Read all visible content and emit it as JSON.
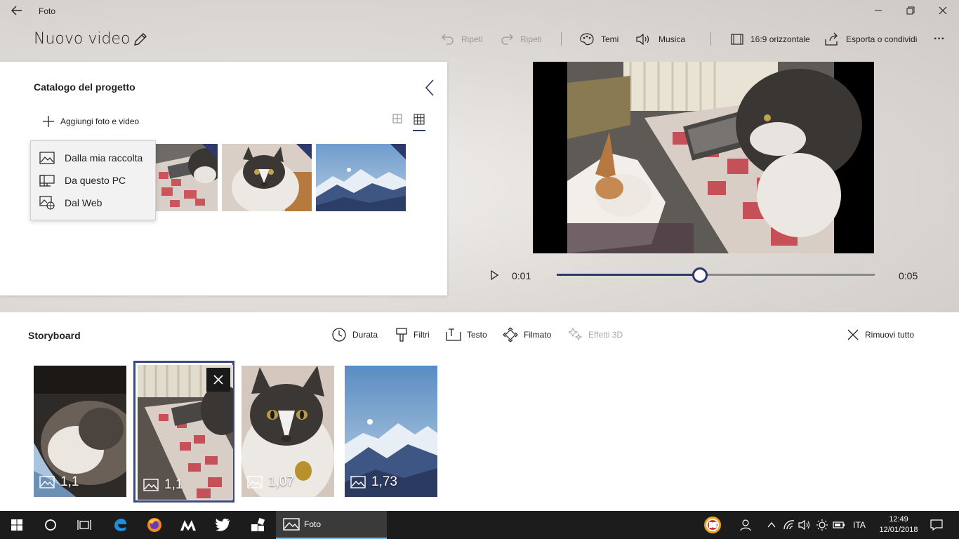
{
  "window": {
    "app_title": "Foto",
    "back_icon": "back-arrow-icon",
    "controls": [
      "minimize-icon",
      "restore-icon",
      "close-icon"
    ]
  },
  "header": {
    "project_title": "Nuovo video",
    "edit_icon": "pencil-icon",
    "undo_label": "Ripeti",
    "redo_label": "Ripeti",
    "themes_label": "Temi",
    "music_label": "Musica",
    "aspect_label": "16:9 orizzontale",
    "export_label": "Esporta o condividi",
    "more_label": "···"
  },
  "catalog": {
    "title": "Catalogo del progetto",
    "add_label": "Aggiungi foto e video",
    "add_menu": [
      {
        "label": "Dalla mia raccolta",
        "icon": "collection-icon"
      },
      {
        "label": "Da questo PC",
        "icon": "pc-icon"
      },
      {
        "label": "Dal Web",
        "icon": "web-icon"
      }
    ],
    "thumbnails": [
      "cat-on-mat",
      "cat-portrait",
      "mountains"
    ]
  },
  "preview": {
    "time_current": "0:01",
    "time_total": "0:05",
    "progress": 0.45
  },
  "storyboard": {
    "title": "Storyboard",
    "tools": {
      "duration": "Durata",
      "filters": "Filtri",
      "text": "Testo",
      "motion": "Filmato",
      "effects3d": "Effetti 3D",
      "remove_all": "Rimuovi tutto"
    },
    "clips": [
      {
        "duration": "1,1",
        "scene": "cat-sleeping"
      },
      {
        "duration": "1,1",
        "scene": "cat-on-mat",
        "selected": true
      },
      {
        "duration": "1,07",
        "scene": "cat-portrait"
      },
      {
        "duration": "1,73",
        "scene": "mountains"
      }
    ]
  },
  "taskbar": {
    "active_app": "Foto",
    "language": "ITA",
    "time": "12:49",
    "date": "12/01/2018"
  },
  "colors": {
    "accent": "#2b3a6b",
    "taskbar": "#1c1c1c",
    "taskbar_active_border": "#76b9ed"
  }
}
